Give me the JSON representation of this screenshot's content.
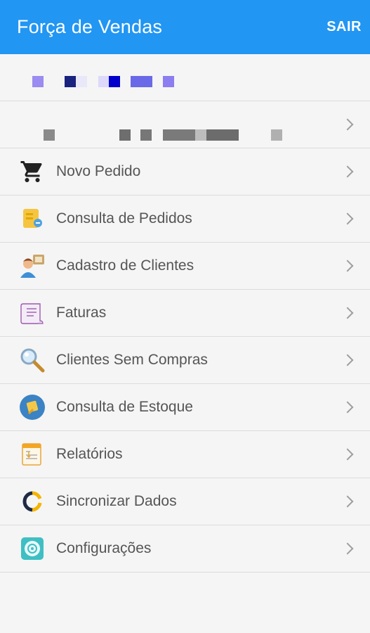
{
  "appbar": {
    "title": "Força de Vendas",
    "action": "SAIR"
  },
  "menu": [
    {
      "label": "Novo Pedido",
      "icon": "cart-icon"
    },
    {
      "label": "Consulta de Pedidos",
      "icon": "orders-folder-icon"
    },
    {
      "label": "Cadastro de Clientes",
      "icon": "client-register-icon"
    },
    {
      "label": "Faturas",
      "icon": "invoice-scroll-icon"
    },
    {
      "label": "Clientes Sem Compras",
      "icon": "magnifier-icon"
    },
    {
      "label": "Consulta de Estoque",
      "icon": "stock-icon"
    },
    {
      "label": "Relatórios",
      "icon": "report-icon"
    },
    {
      "label": "Sincronizar Dados",
      "icon": "sync-icon"
    },
    {
      "label": "Configurações",
      "icon": "settings-icon"
    }
  ],
  "colors": {
    "appbar": "#2196f3",
    "background": "#f5f5f5",
    "divider": "#dcdcdc",
    "label": "#555555"
  }
}
